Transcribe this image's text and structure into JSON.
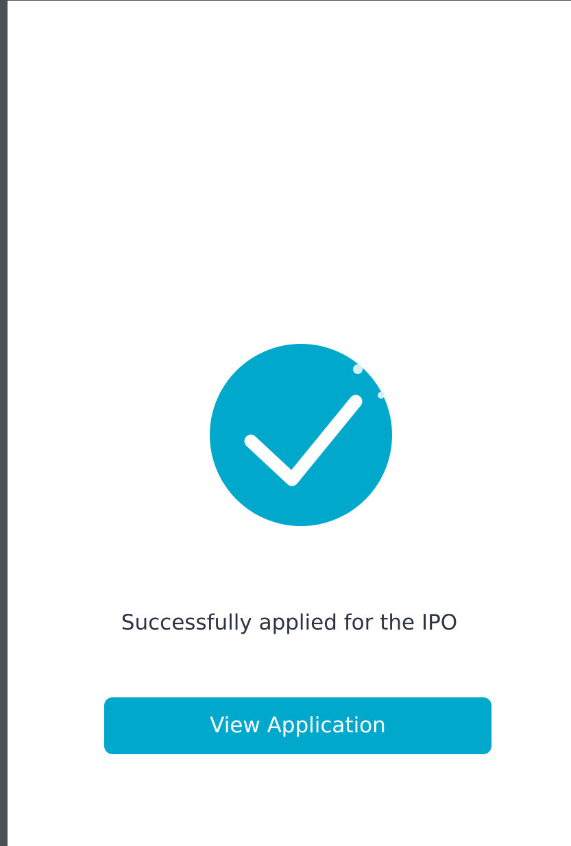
{
  "success": {
    "icon": "check-circle-icon",
    "message": "Successfully applied for the IPO"
  },
  "actions": {
    "view_application_label": "View Application"
  },
  "colors": {
    "accent": "#00a8cc",
    "text": "#2f3442",
    "background": "#ffffff"
  }
}
